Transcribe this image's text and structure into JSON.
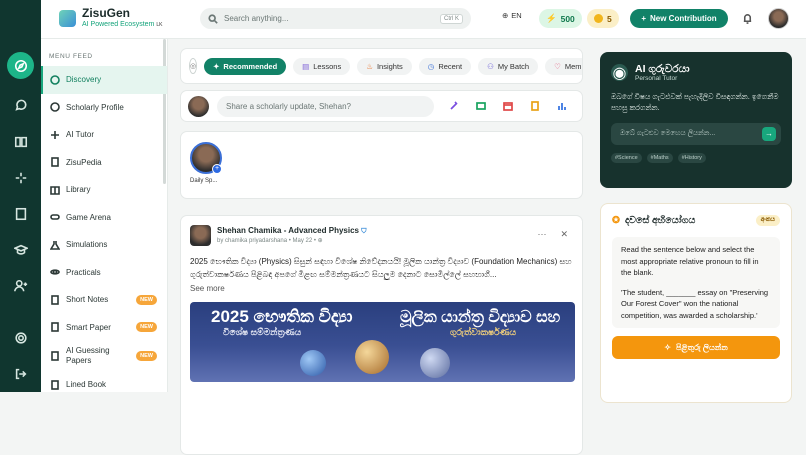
{
  "brand": {
    "name": "ZisuGen",
    "tagline": "AI Powered Ecosystem",
    "tagline_suffix": "LK"
  },
  "search": {
    "placeholder": "Search anything...",
    "shortcut": "Ctrl K"
  },
  "header": {
    "lang": "EN",
    "xp": "500",
    "coins": "5",
    "new_label": "New Contribution"
  },
  "sidebar": {
    "heading": "MENU FEED",
    "items": [
      {
        "label": "Discovery",
        "active": true
      },
      {
        "label": "Scholarly Profile"
      },
      {
        "label": "AI Tutor"
      },
      {
        "label": "ZisuPedia"
      },
      {
        "label": "Library"
      },
      {
        "label": "Game Arena"
      },
      {
        "label": "Simulations"
      },
      {
        "label": "Practicals"
      },
      {
        "label": "Short Notes",
        "badge": "NEW"
      },
      {
        "label": "Smart Paper",
        "badge": "NEW"
      },
      {
        "label": "AI Guessing Papers",
        "badge": "NEW"
      },
      {
        "label": "Lined Book"
      }
    ]
  },
  "feed_tabs": [
    "Recommended",
    "Lessons",
    "Insights",
    "Recent",
    "My Batch",
    "Mem"
  ],
  "composer": {
    "placeholder": "Share a scholarly update, Shehan?"
  },
  "story": {
    "label": "Daily Sp..."
  },
  "post": {
    "author": "Shehan Chamika - Advanced Physics",
    "meta_by": "by chamika priyadarshana",
    "meta_date": "May 22",
    "body": "2025 භෞතික විද්‍යා (Physics) සිසුන් සඳහා විශේෂ නිවේදනයයි! මූලික යාන්ත්‍ර විද්‍යාව (Foundation Mechanics) සහ ගුරුත්වාකර්ෂණය පිළිබඳ අපගේ මීළඟ සම්මන්ත්‍රණයට සියලුම දෙනාට සොමිල්ලේ සහභාගී...",
    "see_more": "See more",
    "hero_left_title": "2025 භෞතික විද්‍යා",
    "hero_left_sub": "විශේෂ සම්මන්ත්‍රණය",
    "hero_right_title": "මූලික යාන්ත්‍ර විද්‍යාව සහ",
    "hero_right_sub": "ගුරුත්වාකර්ෂණය"
  },
  "tutor": {
    "title": "AI ගුරුවරයා",
    "subtitle": "Personal Tutor",
    "desc": "ඔබගේ විෂය ගැටළුවක් පැහැදිලිව විසඳගන්න. ඉගෙනීම පහසු කරගන්න.",
    "input_placeholder": "ඔබේ ගැටළුව මෙහෙය ලියන්න...",
    "tags": [
      "#Science",
      "#Maths",
      "#History"
    ]
  },
  "daily": {
    "title": "දවසේ අභියෝගය",
    "tag": "අංකය",
    "question": "Read the sentence below and select the most appropriate relative pronoun to fill in the blank.",
    "sentence": "'The student, _______ essay on \"Preserving Our Forest Cover\" won the national competition, was awarded a scholarship.'",
    "answer_label": "පිළිතුරු ලියන්න"
  },
  "colors": {
    "primary": "#128267",
    "accent": "#18a77d",
    "rail": "#10362f",
    "orange": "#f4960d"
  }
}
